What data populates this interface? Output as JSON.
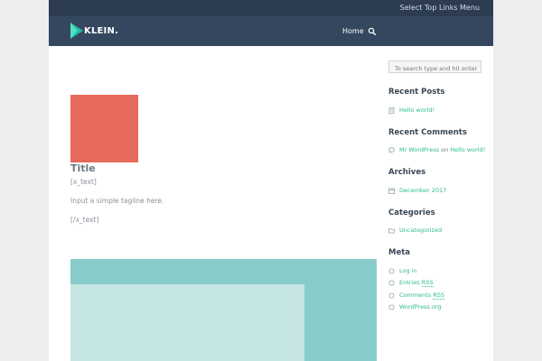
{
  "topbar": {
    "links_label": "Select Top Links Menu"
  },
  "header": {
    "logo_text": "KLEIN.",
    "nav": {
      "home": "Home"
    }
  },
  "post": {
    "title": "Title",
    "lines": [
      "[x_text]",
      "Input a simple tagline here.",
      "[/x_text]"
    ]
  },
  "sidebar": {
    "search_placeholder": "To search type and hit enter",
    "recent_posts": {
      "title": "Recent Posts",
      "items": [
        "Hello world!"
      ]
    },
    "recent_comments": {
      "title": "Recent Comments",
      "author": "Mr WordPress",
      "on": "on",
      "post": "Hello world!"
    },
    "archives": {
      "title": "Archives",
      "items": [
        "December 2017"
      ]
    },
    "categories": {
      "title": "Categories",
      "items": [
        "Uncategorized"
      ]
    },
    "meta": {
      "title": "Meta",
      "login": "Log in",
      "entries": "Entries",
      "comments": "Comments",
      "rss": "RSS",
      "wordpress": "WordPress.org"
    }
  },
  "colors": {
    "topbar_bg": "#2c3c51",
    "header_bg": "#35475f",
    "accent": "#2dbb93",
    "thumb": "#e66a5b",
    "hero_outer": "#88cdcb",
    "hero_inner": "#c6e6e3"
  },
  "icons": {
    "logo": "triangle-logo-icon",
    "search": "search-icon",
    "post": "document-icon",
    "comment": "speech-bubble-icon",
    "archive": "calendar-icon",
    "category": "folder-icon",
    "meta": "circle-bullet-icon"
  }
}
